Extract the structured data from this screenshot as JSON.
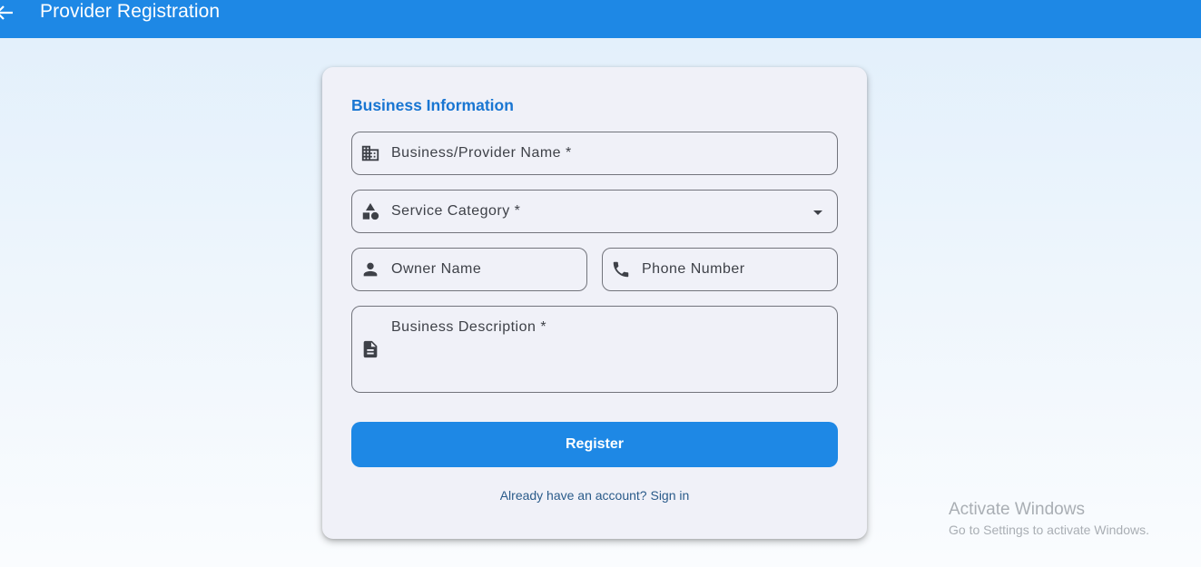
{
  "appbar": {
    "title": "Provider Registration",
    "back_icon": "arrow-back-icon",
    "background": "#1e88e5"
  },
  "form": {
    "section_title": "Business Information",
    "fields": {
      "business_name": {
        "label": "Business/Provider Name *",
        "icon": "building-icon",
        "value": ""
      },
      "service_category": {
        "label": "Service Category *",
        "icon": "category-shapes-icon",
        "value": ""
      },
      "owner_name": {
        "label": "Owner Name",
        "icon": "person-icon",
        "value": ""
      },
      "phone_number": {
        "label": "Phone Number",
        "icon": "phone-icon",
        "value": ""
      },
      "business_description": {
        "label": "Business Description *",
        "icon": "document-icon",
        "value": ""
      }
    },
    "register_label": "Register",
    "signin_text": "Already have an account? Sign in",
    "accent": "#1976d2"
  },
  "watermark": {
    "title": "Activate Windows",
    "subtitle": "Go to Settings to activate Windows."
  }
}
